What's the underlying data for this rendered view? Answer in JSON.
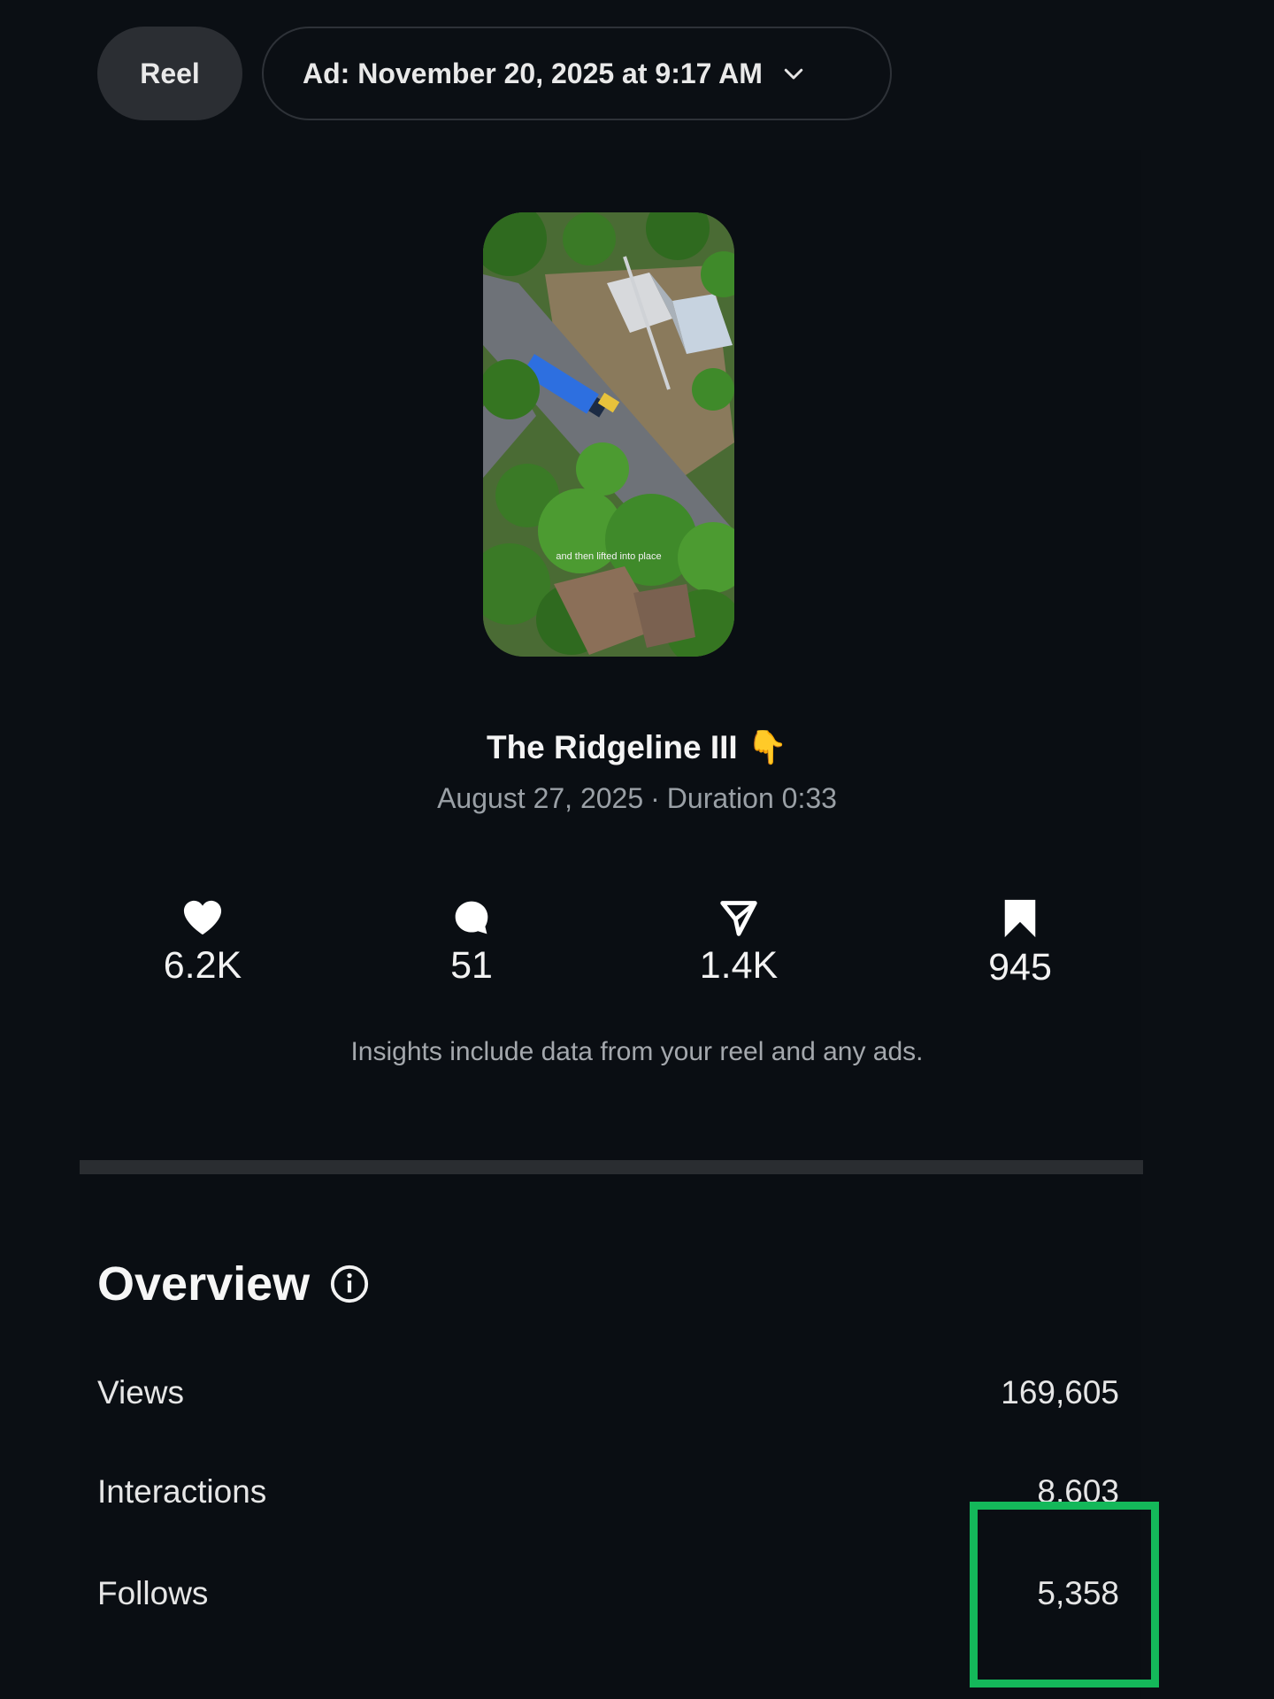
{
  "header": {
    "reel_tab_label": "Reel",
    "ad_selector_label": "Ad: November 20, 2025 at 9:17 AM"
  },
  "post": {
    "title": "The Ridgeline III 👇",
    "date": "August 27, 2025",
    "separator": "·",
    "duration": "Duration 0:33",
    "thumbnail_caption": "and then lifted into place"
  },
  "stats": [
    {
      "icon": "heart-icon",
      "value": "6.2K"
    },
    {
      "icon": "comment-icon",
      "value": "51"
    },
    {
      "icon": "share-icon",
      "value": "1.4K"
    },
    {
      "icon": "bookmark-icon",
      "value": "945"
    }
  ],
  "note": "Insights include data from your reel and any ads.",
  "overview": {
    "title": "Overview",
    "rows": [
      {
        "label": "Views",
        "value": "169,605"
      },
      {
        "label": "Interactions",
        "value": "8,603"
      },
      {
        "label": "Follows",
        "value": "5,358"
      }
    ]
  },
  "colors": {
    "background": "#0b0f14",
    "highlight": "#14b85a"
  }
}
